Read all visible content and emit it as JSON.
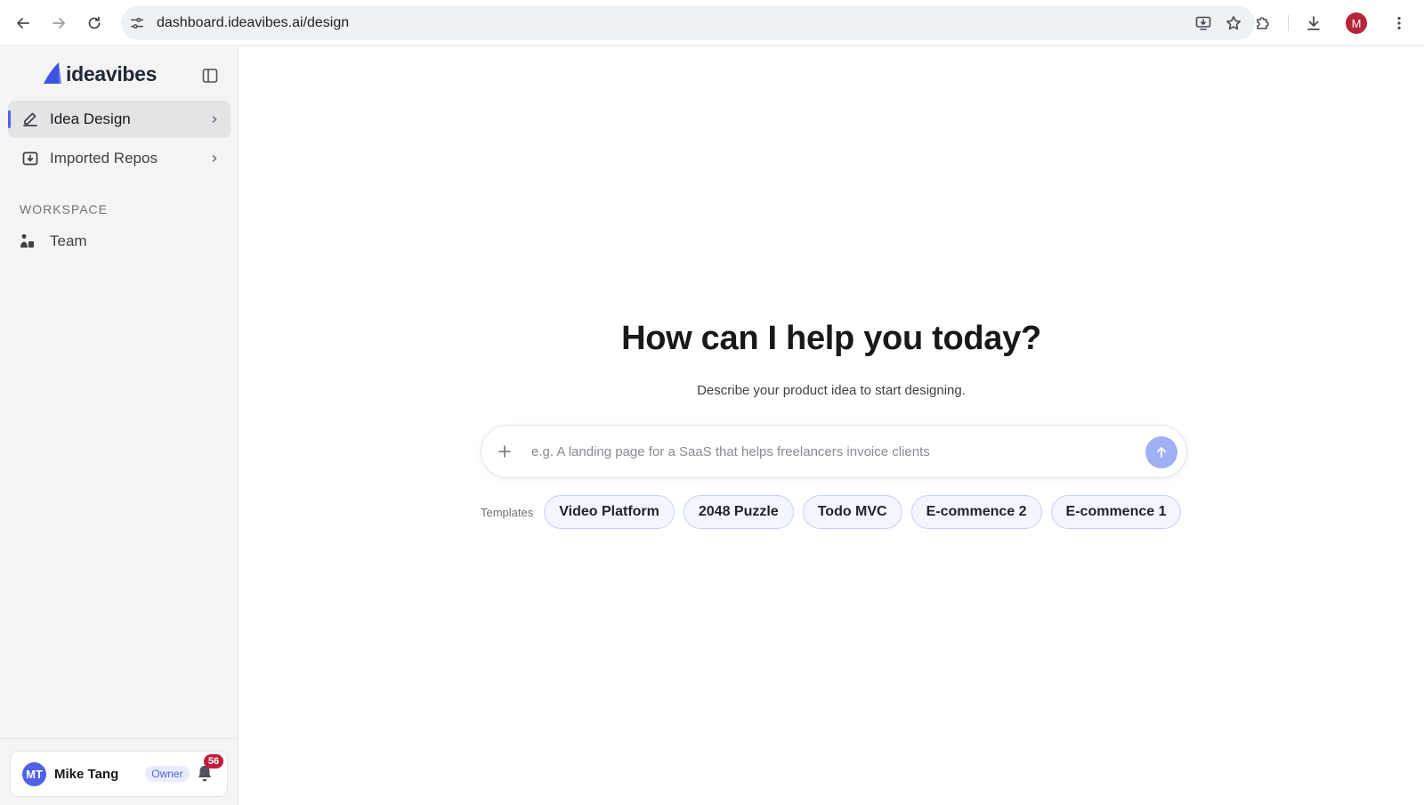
{
  "browser": {
    "url": "dashboard.ideavibes.ai/design",
    "profile_initial": "M"
  },
  "sidebar": {
    "brand": "ideavibes",
    "items": [
      {
        "label": "Idea Design",
        "icon": "pencil-icon",
        "active": true
      },
      {
        "label": "Imported Repos",
        "icon": "import-box-icon",
        "active": false
      }
    ],
    "section_label": "WORKSPACE",
    "workspace_items": [
      {
        "label": "Team",
        "icon": "team-icon"
      }
    ],
    "user": {
      "initials": "MT",
      "name": "Mike Tang",
      "role": "Owner",
      "notification_count": "56"
    }
  },
  "main": {
    "title": "How can I help you today?",
    "subtitle": "Describe your product idea to start designing.",
    "prompt": {
      "value": "",
      "placeholder": "e.g. A landing page for a SaaS that helps freelancers invoice clients"
    },
    "templates_label": "Templates",
    "templates": [
      "Video Platform",
      "2048 Puzzle",
      "Todo MVC",
      "E-commence 2",
      "E-commence 1"
    ]
  },
  "colors": {
    "accent": "#4f63e6",
    "send_button": "#9fb0f5",
    "badge": "#be1e3a"
  }
}
